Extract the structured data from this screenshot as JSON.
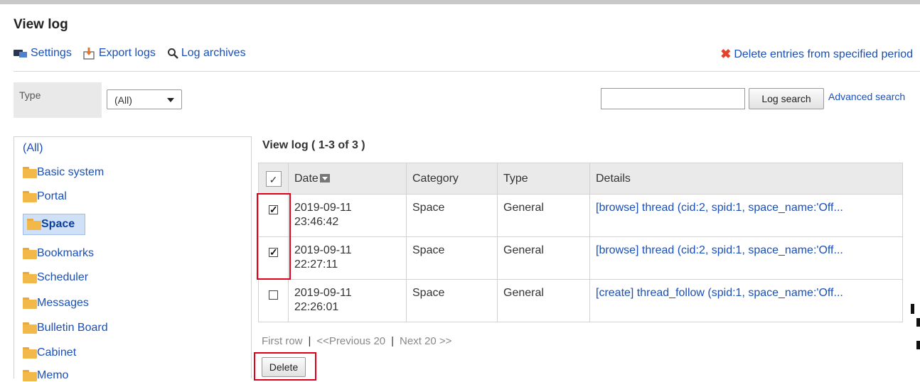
{
  "header": {
    "title": "View log"
  },
  "toolbar": {
    "settings": "Settings",
    "export_logs": "Export logs",
    "log_archives": "Log archives",
    "delete_period": "Delete entries from specified period"
  },
  "filter": {
    "type_label": "Type",
    "type_value": "(All)"
  },
  "search": {
    "button": "Log search",
    "advanced": "Advanced search"
  },
  "sidebar": {
    "all": "(All)",
    "items": [
      "Basic system",
      "Portal",
      "Space",
      "Bookmarks",
      "Scheduler",
      "Messages",
      "Bulletin Board",
      "Cabinet",
      "Memo"
    ],
    "selected": "Space"
  },
  "main": {
    "title": "View log ( 1-3  of 3 )",
    "columns": [
      "Date",
      "Category",
      "Type",
      "Details"
    ],
    "rows": [
      {
        "checked": true,
        "date": "2019-09-11",
        "time": "23:46:42",
        "category": "Space",
        "type": "General",
        "details": "[browse] thread (cid:2, spid:1, space_name:'Off..."
      },
      {
        "checked": true,
        "date": "2019-09-11",
        "time": "22:27:11",
        "category": "Space",
        "type": "General",
        "details": "[browse] thread (cid:2, spid:1, space_name:'Off..."
      },
      {
        "checked": false,
        "date": "2019-09-11",
        "time": "22:26:01",
        "category": "Space",
        "type": "General",
        "details": "[create] thread_follow (spid:1, space_name:'Off..."
      }
    ],
    "pager": {
      "first": "First row",
      "prev": "<<Previous 20",
      "next": "Next 20 >>"
    },
    "delete_button": "Delete"
  },
  "colors": {
    "link": "#1a4fb7",
    "highlight": "#e0001a",
    "folder": "#f2b84a"
  }
}
